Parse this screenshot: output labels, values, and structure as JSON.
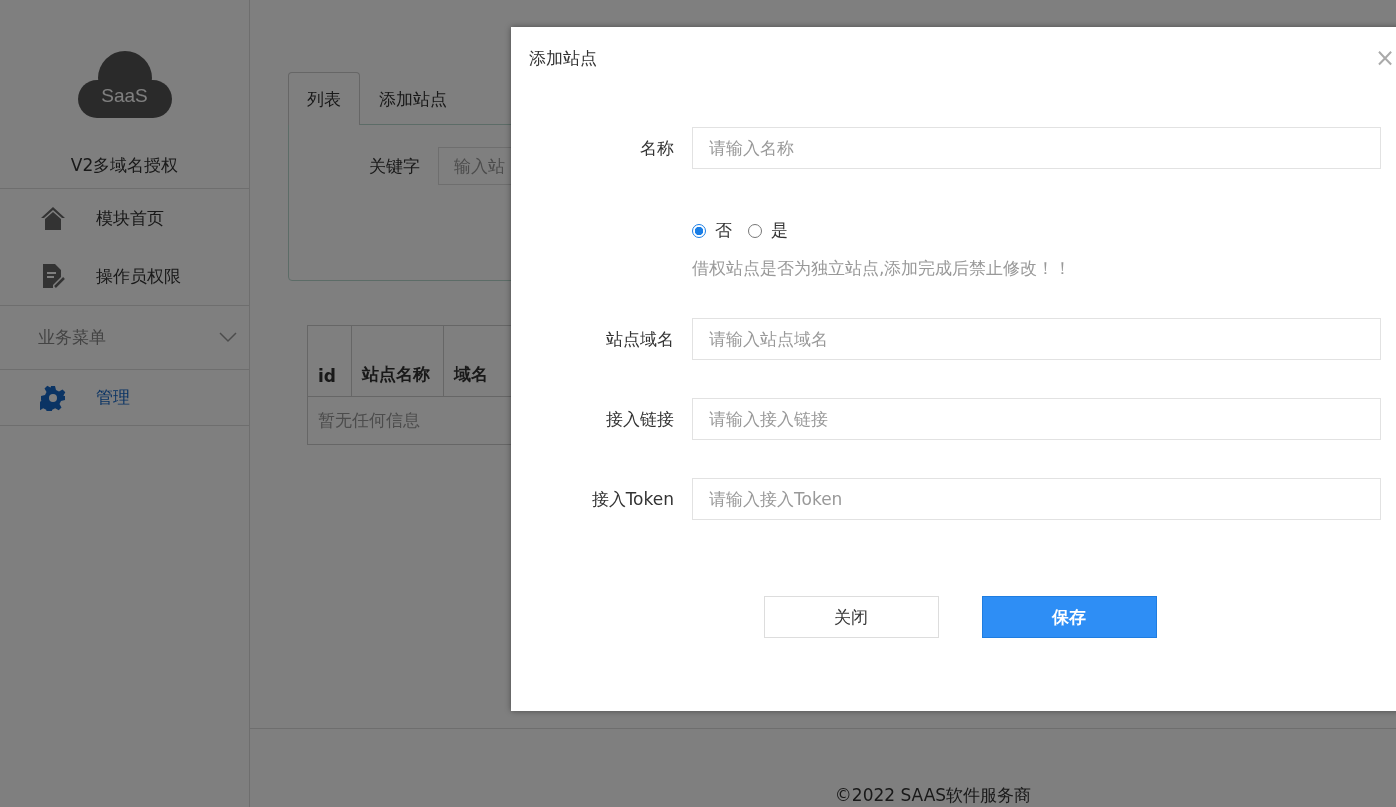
{
  "sidebar": {
    "logo_text": "SaaS",
    "title": "V2多域名授权",
    "items": [
      {
        "label": "模块首页",
        "kind": "home",
        "selected": false
      },
      {
        "label": "操作员权限",
        "kind": "document",
        "selected": false
      }
    ],
    "section": {
      "label": "业务菜单",
      "expanded": true,
      "items": [
        {
          "label": "管理",
          "kind": "gear",
          "selected": true
        }
      ]
    }
  },
  "main": {
    "tabs": [
      {
        "label": "列表",
        "selected": true
      },
      {
        "label": "添加站点",
        "selected": false
      }
    ],
    "search": {
      "label": "关键字",
      "placeholder": "输入站"
    },
    "table": {
      "columns": [
        "id",
        "站点名称",
        "域名"
      ],
      "empty": "暂无任何信息"
    },
    "footer": "©2022 SAAS软件服务商"
  },
  "dialog": {
    "title": "添加站点",
    "close": "×",
    "fields": [
      {
        "kind": "text",
        "label": "名称",
        "placeholder": "请输入名称"
      },
      {
        "kind": "radio",
        "options": [
          {
            "label": "否",
            "selected": true
          },
          {
            "label": "是",
            "selected": false
          }
        ],
        "hint": "借权站点是否为独立站点,添加完成后禁止修改！！"
      },
      {
        "kind": "text",
        "label": "站点域名",
        "placeholder": "请输入站点域名"
      },
      {
        "kind": "text",
        "label": "接入链接",
        "placeholder": "请输入接入链接"
      },
      {
        "kind": "text",
        "label": "接入Token",
        "placeholder": "请输入接入Token"
      }
    ],
    "buttons": [
      {
        "label": "关闭",
        "kind": "default"
      },
      {
        "label": "保存",
        "kind": "primary"
      }
    ]
  }
}
